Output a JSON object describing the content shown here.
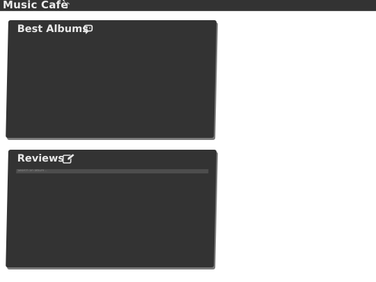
{
  "app": {
    "title": "Music Cafè",
    "title_icon": "music-note-icon"
  },
  "panels": {
    "albums": {
      "title": "Best Albums",
      "icon": "chat-bubble-icon"
    },
    "reviews": {
      "title": "Reviews",
      "icon": "edit-pencil-icon",
      "search": {
        "placeholder": "Search an album...",
        "value": ""
      }
    }
  },
  "colors": {
    "topbar_bg": "#333333",
    "panel_bg": "#333333",
    "panel_shadow": "#7a7a7a",
    "text": "#e9e9e9",
    "search_bg": "#4d4d4d",
    "page_bg": "#ffffff"
  }
}
